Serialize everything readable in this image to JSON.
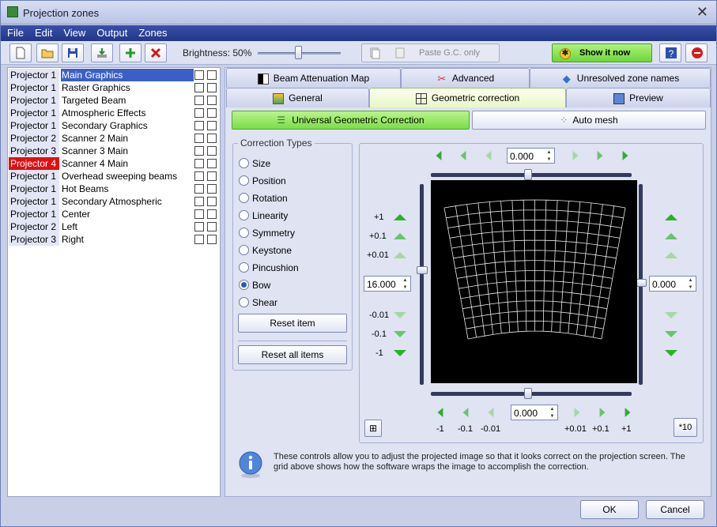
{
  "window": {
    "title": "Projection zones"
  },
  "menu": [
    "File",
    "Edit",
    "View",
    "Output",
    "Zones"
  ],
  "toolbar": {
    "brightness_label": "Brightness: 50%",
    "brightness_value": 0.5,
    "paste_label": "Paste G.C. only",
    "show_label": "Show it now"
  },
  "zones": [
    {
      "projector": "Projector 1",
      "name": "Main Graphics"
    },
    {
      "projector": "Projector 1",
      "name": "Raster Graphics"
    },
    {
      "projector": "Projector 1",
      "name": "Targeted Beam"
    },
    {
      "projector": "Projector 1",
      "name": "Atmospheric Effects"
    },
    {
      "projector": "Projector 1",
      "name": "Secondary Graphics"
    },
    {
      "projector": "Projector 2",
      "name": "Scanner 2 Main"
    },
    {
      "projector": "Projector 3",
      "name": "Scanner 3 Main"
    },
    {
      "projector": "Projector 4",
      "name": "Scanner 4 Main"
    },
    {
      "projector": "Projector 1",
      "name": "Overhead sweeping beams"
    },
    {
      "projector": "Projector 1",
      "name": "Hot Beams"
    },
    {
      "projector": "Projector 1",
      "name": "Secondary Atmospheric"
    },
    {
      "projector": "Projector 1",
      "name": "Center"
    },
    {
      "projector": "Projector 2",
      "name": "Left"
    },
    {
      "projector": "Projector 3",
      "name": "Right"
    }
  ],
  "tabs": {
    "row1": [
      "Beam Attenuation Map",
      "Advanced",
      "Unresolved zone names"
    ],
    "row2": [
      "General",
      "Geometric correction",
      "Preview"
    ]
  },
  "subtabs": [
    "Universal Geometric Correction",
    "Auto mesh"
  ],
  "correction": {
    "legend": "Correction Types",
    "types": [
      "Size",
      "Position",
      "Rotation",
      "Linearity",
      "Symmetry",
      "Keystone",
      "Pincushion",
      "Bow",
      "Shear"
    ],
    "selected": "Bow",
    "reset_item": "Reset item",
    "reset_all": "Reset all items"
  },
  "grid": {
    "top_value": "0.000",
    "bottom_value": "0.000",
    "left_value": "16.000",
    "right_value": "0.000",
    "vlabels_up": [
      "+1",
      "+0.1",
      "+0.01"
    ],
    "vlabels_down": [
      "-0.01",
      "-0.1",
      "-1"
    ],
    "hlabels": [
      "-1",
      "-0.1",
      "-0.01",
      "+0.01",
      "+0.1",
      "+1"
    ],
    "x10_label": "*10"
  },
  "info": {
    "text": "These controls allow you to adjust the projected image so that it looks correct on the projection screen. The grid above shows how the software wraps the image to accomplish the correction."
  },
  "footer": {
    "ok": "OK",
    "cancel": "Cancel"
  },
  "colors": {
    "accent_green": "#7cdc4a",
    "selection_blue": "#3c5fc7",
    "alert_red": "#e01010"
  }
}
